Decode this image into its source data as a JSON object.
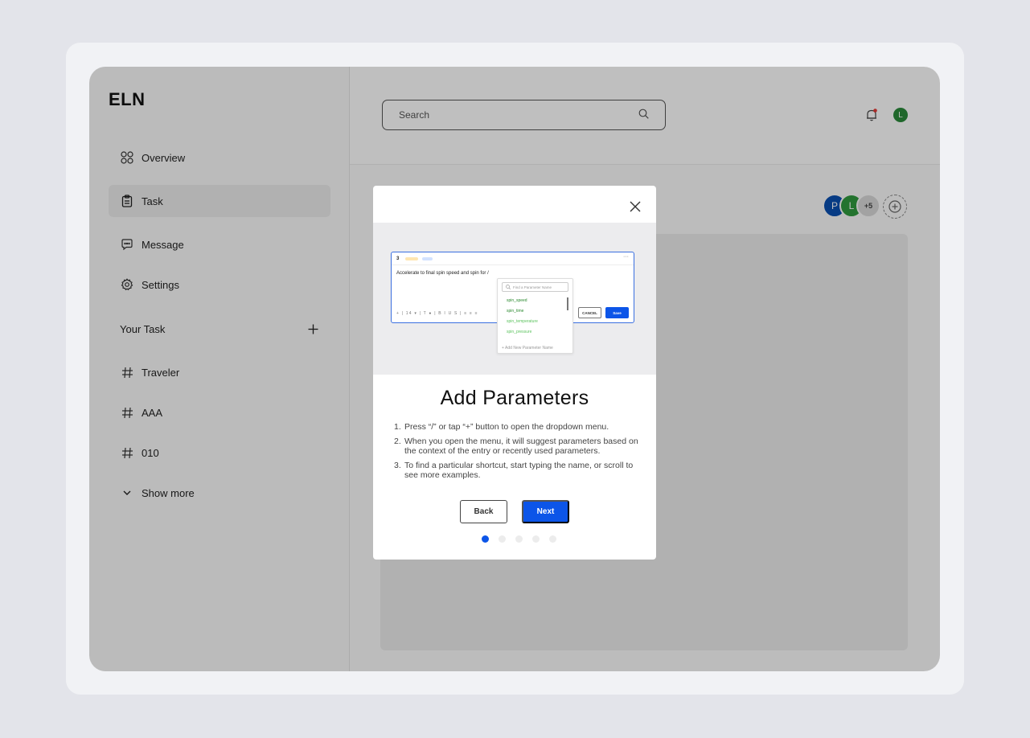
{
  "app": {
    "logo": "ELN"
  },
  "sidebar": {
    "items": [
      {
        "label": "Overview",
        "icon": "grid-icon"
      },
      {
        "label": "Task",
        "icon": "clipboard-icon"
      },
      {
        "label": "Message",
        "icon": "chat-icon"
      },
      {
        "label": "Settings",
        "icon": "gear-icon"
      }
    ],
    "section_title": "Your Task",
    "tasks": [
      {
        "label": "Traveler",
        "icon": "hash-icon"
      },
      {
        "label": "AAA",
        "icon": "hash-icon"
      },
      {
        "label": "010",
        "icon": "hash-icon"
      }
    ],
    "show_more": "Show more"
  },
  "header": {
    "search_placeholder": "Search",
    "user_initial": "L"
  },
  "collaborators": {
    "avatars": [
      "P",
      "L"
    ],
    "more": "+5"
  },
  "modal": {
    "title": "Add Parameters",
    "steps": [
      {
        "n": "1.",
        "text": "Press “/” or tap “+” button to open the dropdown menu."
      },
      {
        "n": "2.",
        "text": "When you open the menu, it will suggest parameters based on the context of the entry or recently used parameters."
      },
      {
        "n": "3.",
        "text": "To find a particular shortcut, start typing the name, or scroll to see more examples."
      }
    ],
    "back_label": "Back",
    "next_label": "Next",
    "page_count": 5,
    "current_page": 1,
    "preview": {
      "entry_number": "3",
      "text": "Accelerate to final spin speed and spin for /",
      "toolbar": "+ | 14 ▾ | T ● | B I U S | ≡ ≡ ≡",
      "cancel_label": "CANCEL",
      "save_label": "Save",
      "dropdown_placeholder": "Find a Parameter Name",
      "dropdown_items": [
        "spin_speed",
        "spin_time",
        "spin_temperature",
        "spin_pressure"
      ],
      "dropdown_add": "Add New Parameter Name"
    }
  },
  "colors": {
    "accent": "#0c55e8",
    "online": "#2a8a3a"
  }
}
